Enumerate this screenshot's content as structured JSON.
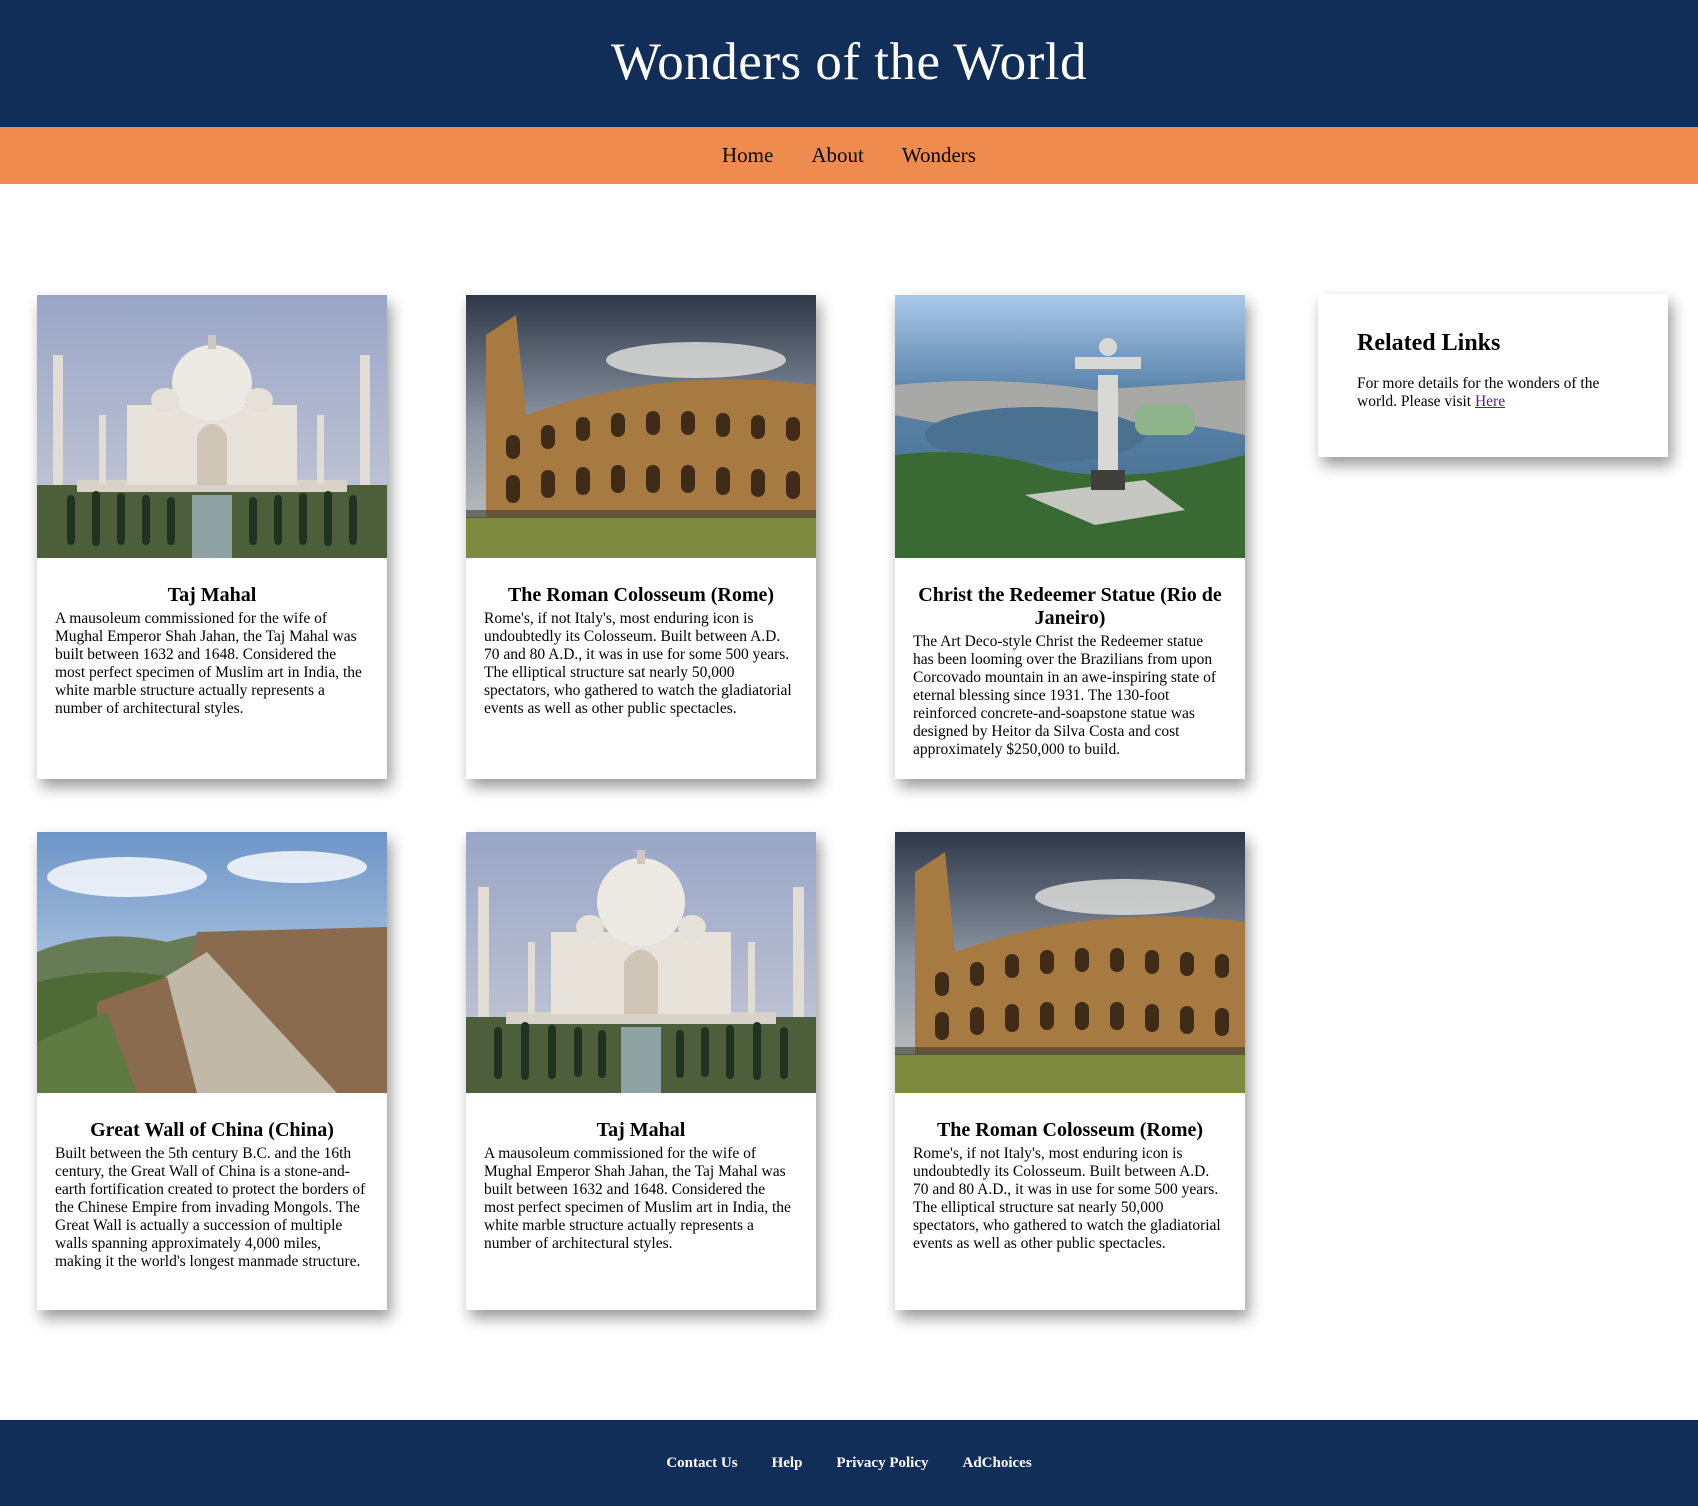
{
  "header": {
    "title": "Wonders of the World"
  },
  "nav": {
    "items": [
      "Home",
      "About",
      "Wonders"
    ]
  },
  "cards": [
    {
      "image": "taj-mahal",
      "title": "Taj Mahal",
      "text": "A mausoleum commissioned for the wife of Mughal Emperor Shah Jahan, the Taj Mahal was built between 1632 and 1648. Considered the most perfect specimen of Muslim art in India, the white marble structure actually represents a number of architectural styles."
    },
    {
      "image": "roman-colosseum",
      "title": "The Roman Colosseum (Rome)",
      "text": "Rome's, if not Italy's, most enduring icon is undoubtedly its Colosseum. Built between A.D. 70 and 80 A.D., it was in use for some 500 years. The elliptical structure sat nearly 50,000 spectators, who gathered to watch the gladiatorial events as well as other public spectacles."
    },
    {
      "image": "christ-the-redeemer",
      "title": "Christ the Redeemer Statue (Rio de Janeiro)",
      "text": "The Art Deco-style Christ the Redeemer statue has been looming over the Brazilians from upon Corcovado mountain in an awe-inspiring state of eternal blessing since 1931. The 130-foot reinforced concrete-and-soapstone statue was designed by Heitor da Silva Costa and cost approximately $250,000 to build."
    },
    {
      "image": "great-wall",
      "title": "Great Wall of China (China)",
      "text": "Built between the 5th century B.C. and the 16th century, the Great Wall of China is a stone-and-earth fortification created to protect the borders of the Chinese Empire from invading Mongols. The Great Wall is actually a succession of multiple walls spanning approximately 4,000 miles, making it the world's longest manmade structure."
    },
    {
      "image": "taj-mahal",
      "title": "Taj Mahal",
      "text": "A mausoleum commissioned for the wife of Mughal Emperor Shah Jahan, the Taj Mahal was built between 1632 and 1648. Considered the most perfect specimen of Muslim art in India, the white marble structure actually represents a number of architectural styles."
    },
    {
      "image": "roman-colosseum",
      "title": "The Roman Colosseum (Rome)",
      "text": "Rome's, if not Italy's, most enduring icon is undoubtedly its Colosseum. Built between A.D. 70 and 80 A.D., it was in use for some 500 years. The elliptical structure sat nearly 50,000 spectators, who gathered to watch the gladiatorial events as well as other public spectacles."
    }
  ],
  "related": {
    "title": "Related Links",
    "text": "For more details for the wonders of the world. Please visit",
    "link": "Here"
  },
  "footer": {
    "links": [
      "Contact Us",
      "Help",
      "Privacy Policy",
      "AdChoices"
    ]
  },
  "colors": {
    "header": "#102e58",
    "nav": "#ef8b4f",
    "link_visited": "#551a8b"
  }
}
